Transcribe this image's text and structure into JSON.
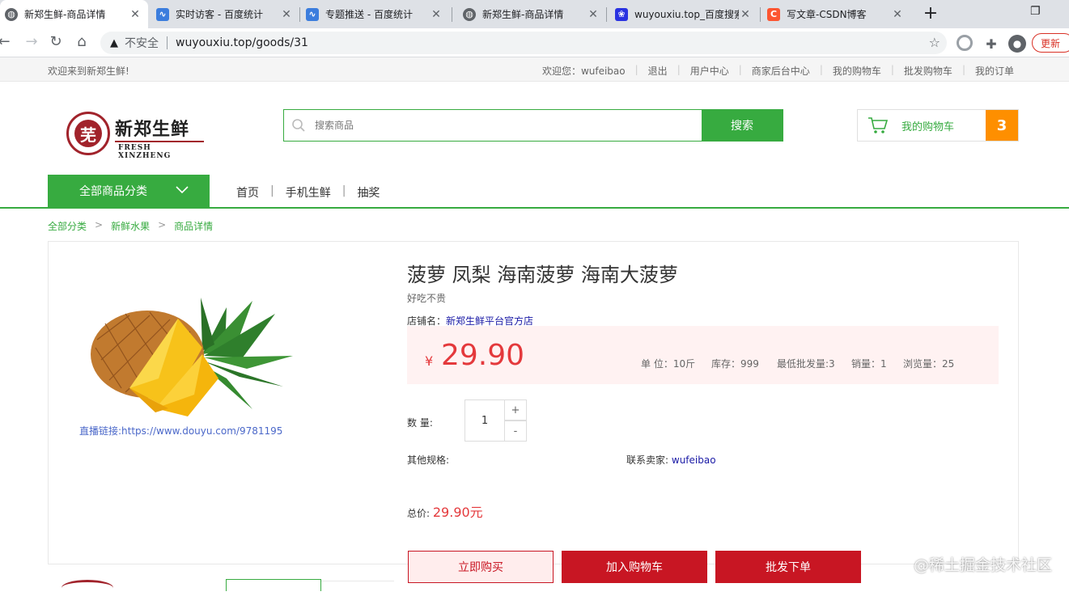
{
  "browser": {
    "tabs": [
      {
        "label": "新郑生鲜-商品详情",
        "active": true,
        "icon": "globe-icon"
      },
      {
        "label": "实时访客 - 百度统计",
        "active": false,
        "icon": "baidu-tongji-icon"
      },
      {
        "label": "专题推送 - 百度统计",
        "active": false,
        "icon": "baidu-tongji-icon"
      },
      {
        "label": "新郑生鲜-商品详情",
        "active": false,
        "icon": "globe-icon"
      },
      {
        "label": "wuyouxiu.top_百度搜索",
        "active": false,
        "icon": "baidu-paw-icon"
      },
      {
        "label": "写文章-CSDN博客",
        "active": false,
        "icon": "csdn-icon"
      }
    ],
    "security_label": "不安全",
    "url": "wuyouxiu.top/goods/31",
    "update_label": "更新"
  },
  "site_top": {
    "welcome": "欢迎来到新郑生鲜!",
    "greeting": "欢迎您：wufeibao",
    "links": [
      "退出",
      "用户中心",
      "商家后台中心",
      "我的购物车",
      "批发购物车",
      "我的订单"
    ]
  },
  "header": {
    "logo_name": "新郑生鲜",
    "logo_en": "FRESH XINZHENG",
    "logo_emblem_char": "芜",
    "search_placeholder": "搜索商品",
    "search_button": "搜索",
    "cart_label": "我的购物车",
    "cart_count": "3"
  },
  "nav": {
    "all_categories": "全部商品分类",
    "links": [
      "首页",
      "手机生鲜",
      "抽奖"
    ]
  },
  "breadcrumb": [
    "全部分类",
    "新鲜水果",
    "商品详情"
  ],
  "product": {
    "title": "菠萝 凤梨 海南菠萝 海南大菠萝",
    "subtitle": "好吃不贵",
    "store_label": "店铺名：",
    "store_name": "新郑生鲜平台官方店",
    "currency": "¥",
    "price": "29.90",
    "meta": {
      "unit": "单 位：10斤",
      "stock": "库存：999",
      "min_batch": "最低批发量:3",
      "sales": "销量：1",
      "views": "浏览量：25"
    },
    "live_link": "直播链接:https://www.douyu.com/9781195",
    "quantity_label": "数 量:",
    "quantity": "1",
    "plus": "+",
    "minus": "-",
    "other_spec": "其他规格:",
    "contact_label": "联系卖家:",
    "seller": "wufeibao",
    "total_label": "总价:",
    "total_value": "29.90元",
    "buttons": {
      "buy": "立即购买",
      "add_cart": "加入购物车",
      "batch": "批发下单"
    }
  },
  "watermark": "@稀土掘金技术社区",
  "colors": {
    "green": "#37ab40",
    "red": "#e4393c",
    "dark_red": "#c81623",
    "orange": "#fe8f00"
  }
}
